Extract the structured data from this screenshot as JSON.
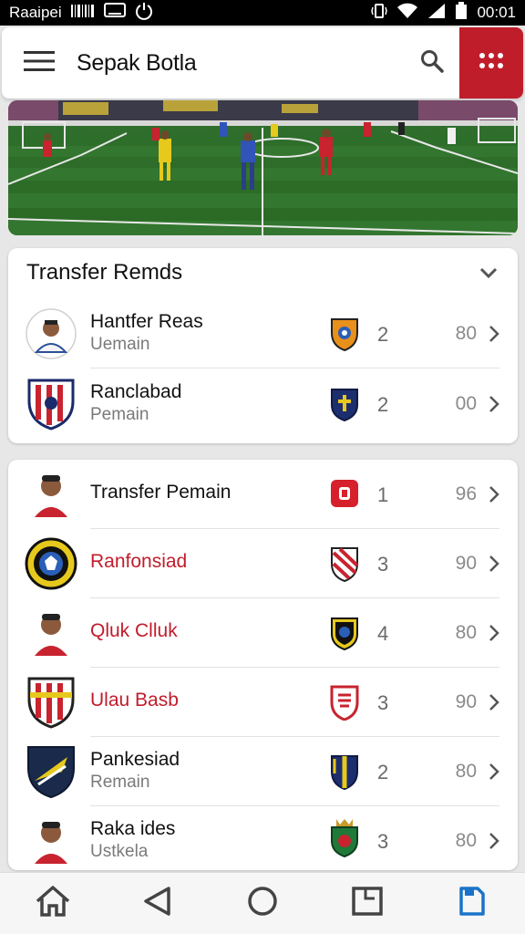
{
  "status_bar": {
    "carrier": "Raaipei",
    "time": "00:01",
    "icons": [
      "barcode-icon",
      "cast-icon",
      "power-icon",
      "vibrate-icon",
      "wifi-icon",
      "signal-icon",
      "battery-icon"
    ]
  },
  "app_bar": {
    "title": "Sepak Botla",
    "menu_icon": "hamburger-menu-icon",
    "search_icon": "search-icon",
    "apps_icon": "grid-dots-icon",
    "accent_color": "#c01d2a"
  },
  "hero": {
    "image": "football-match-photo"
  },
  "section1": {
    "title": "Transfer Remds",
    "rows": [
      {
        "name": "Hantfer Reas",
        "sub": "Uemain",
        "count": "2",
        "score": "80",
        "avatar": "player-photo",
        "crest": "orange-shield-crest"
      },
      {
        "name": "Ranclabad",
        "sub": "Pemain",
        "count": "2",
        "score": "00",
        "avatar": "red-striped-shield",
        "crest": "navy-cross-crest"
      }
    ]
  },
  "section2": {
    "rows": [
      {
        "name": "Transfer Pemain",
        "sub": "",
        "count": "1",
        "score": "96",
        "avatar": "player-photo",
        "crest": "red-square-crest"
      },
      {
        "name": "Ranfonsiad",
        "sub": "",
        "count": "3",
        "score": "90",
        "avatar": "round-yellow-badge",
        "crest": "red-diagonal-crest"
      },
      {
        "name": "Qluk Clluk",
        "sub": "",
        "count": "4",
        "score": "80",
        "avatar": "player-photo",
        "crest": "dark-blue-crest"
      },
      {
        "name": "Ulau Basb",
        "sub": "",
        "count": "3",
        "score": "90",
        "avatar": "striped-shield",
        "crest": "red-white-crest"
      },
      {
        "name": "Pankesiad",
        "sub": "Remain",
        "count": "2",
        "score": "80",
        "avatar": "navy-yellow-shield",
        "crest": "navy-yellow-crest"
      },
      {
        "name": "Raka ides",
        "sub": "Ustkela",
        "count": "3",
        "score": "80",
        "avatar": "player-photo",
        "crest": "green-red-crowned-crest"
      }
    ]
  },
  "bottom_nav": {
    "items": [
      "home-icon",
      "back-icon",
      "home-circle-icon",
      "recent-icon",
      "bookmark-icon"
    ],
    "active_color": "#1a73c8"
  }
}
